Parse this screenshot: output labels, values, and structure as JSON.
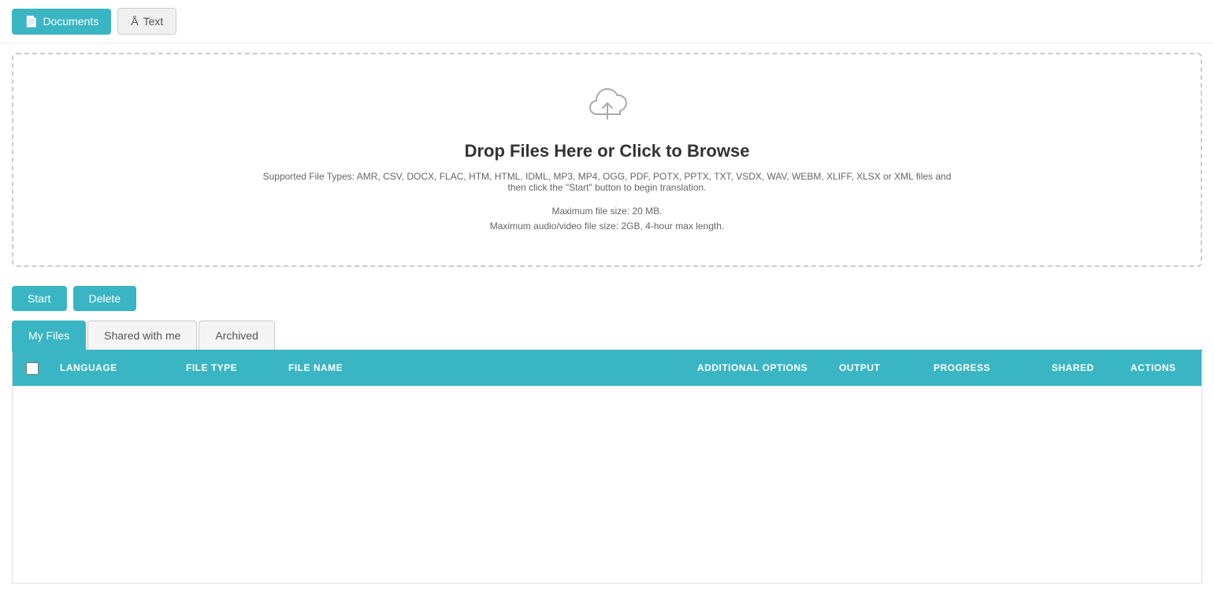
{
  "topNav": {
    "documentsLabel": "Documents",
    "textLabel": "Text"
  },
  "dropZone": {
    "title": "Drop Files Here or Click to Browse",
    "supportedText": "Supported File Types: AMR, CSV, DOCX, FLAC, HTM, HTML, IDML, MP3, MP4, OGG, PDF, POTX, PPTX, TXT, VSDX, WAV, WEBM, XLIFF, XLSX or XML files and then click the \"Start\" button to begin translation.",
    "maxFileSize": "Maximum file size: 20 MB.",
    "maxAudioVideo": "Maximum audio/video file size: 2GB, 4-hour max length."
  },
  "actionButtons": {
    "startLabel": "Start",
    "deleteLabel": "Delete"
  },
  "tabs": [
    {
      "id": "my-files",
      "label": "My Files",
      "active": true
    },
    {
      "id": "shared-with-me",
      "label": "Shared with me",
      "active": false
    },
    {
      "id": "archived",
      "label": "Archived",
      "active": false
    }
  ],
  "tableHeaders": {
    "language": "LANGUAGE",
    "fileType": "FILE TYPE",
    "fileName": "FILE NAME",
    "additionalOptions": "ADDITIONAL OPTIONS",
    "output": "OUTPUT",
    "progress": "PROGRESS",
    "shared": "SHARED",
    "actions": "ACTIONS"
  }
}
